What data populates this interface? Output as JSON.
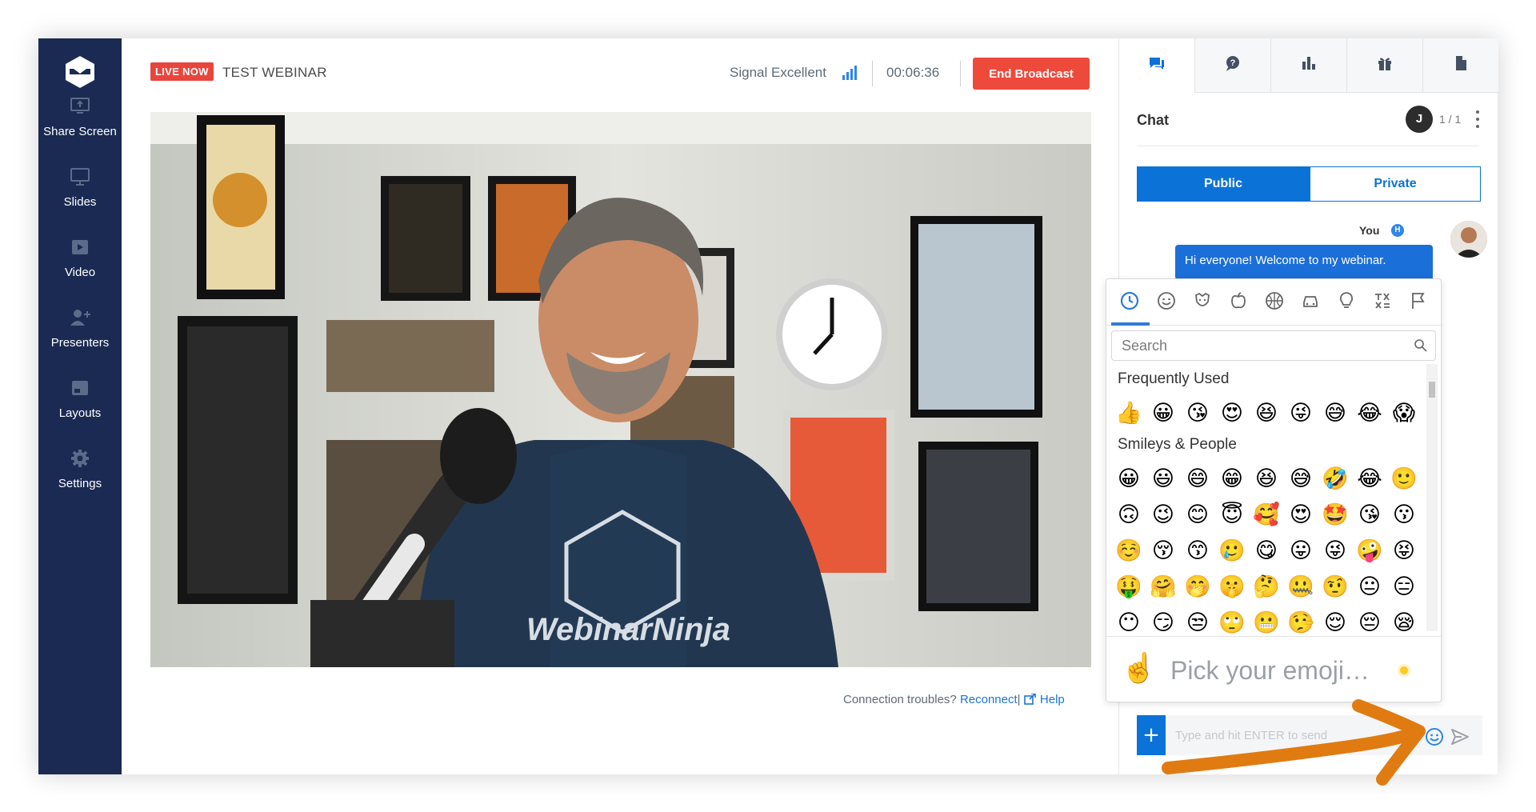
{
  "sidebar": {
    "items": [
      {
        "label": "Share Screen",
        "icon": "share-screen-icon"
      },
      {
        "label": "Slides",
        "icon": "slides-icon"
      },
      {
        "label": "Video",
        "icon": "video-icon"
      },
      {
        "label": "Presenters",
        "icon": "add-presenter-icon"
      },
      {
        "label": "Layouts",
        "icon": "layouts-icon"
      },
      {
        "label": "Settings",
        "icon": "gear-icon"
      }
    ]
  },
  "header": {
    "live_badge": "LIVE NOW",
    "title": "TEST WEBINAR",
    "signal": "Signal Excellent",
    "timer": "00:06:36",
    "end_button": "End Broadcast"
  },
  "video": {
    "connection_text": "Connection troubles?",
    "reconnect": "Reconnect",
    "separator": "|",
    "help": "Help"
  },
  "panel": {
    "tabs": [
      "chat-icon",
      "questions-icon",
      "polls-icon",
      "offers-icon",
      "handouts-icon"
    ],
    "chat_title": "Chat",
    "avatar_initial": "J",
    "count": "1 / 1",
    "public_label": "Public",
    "private_label": "Private",
    "you_label": "You",
    "host_badge": "H",
    "message": "Hi everyone! Welcome to my webinar.",
    "input_placeholder": "Type and hit ENTER to send",
    "plus": "+"
  },
  "emoji_picker": {
    "categories": [
      "recent-icon",
      "smileys-icon",
      "animals-icon",
      "food-icon",
      "activity-icon",
      "travel-icon",
      "objects-icon",
      "symbols-icon",
      "flags-icon"
    ],
    "search_placeholder": "Search",
    "frequently_used_title": "Frequently Used",
    "frequently_used": [
      "👍",
      "😀",
      "😘",
      "😍",
      "😆",
      "😜",
      "😅",
      "😂",
      "😱"
    ],
    "smileys_title": "Smileys & People",
    "smileys_rows": [
      [
        "😀",
        "😃",
        "😄",
        "😁",
        "😆",
        "😅",
        "🤣",
        "😂",
        "🙂"
      ],
      [
        "🙃",
        "😉",
        "😊",
        "😇",
        "🥰",
        "😍",
        "🤩",
        "😘",
        "😗"
      ],
      [
        "☺️",
        "😚",
        "😙",
        "🥲",
        "😋",
        "😛",
        "😜",
        "🤪",
        "😝"
      ],
      [
        "🤑",
        "🤗",
        "🤭",
        "🤫",
        "🤔",
        "🤐",
        "🤨",
        "😐",
        "😑"
      ],
      [
        "😶",
        "😏",
        "😒",
        "🙄",
        "😬",
        "🤥",
        "😌",
        "😔",
        "😪"
      ]
    ],
    "preview_emoji": "☝️",
    "preview_text": "Pick your emoji…"
  },
  "colors": {
    "sidebar": "#1a2a52",
    "accent_blue": "#0b72d8",
    "end_red": "#ee4a3c",
    "annotation_orange": "#e07b12"
  }
}
